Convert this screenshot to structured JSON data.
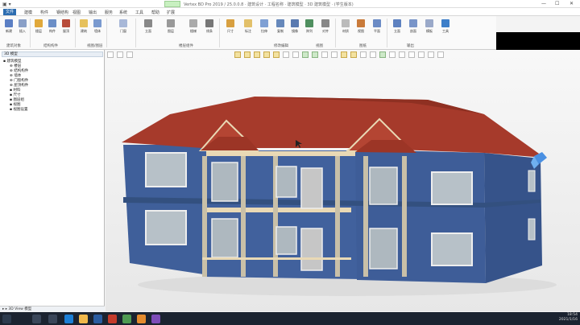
{
  "titlebar": {
    "title": "Vertex BD Pro 2019 / 25.0.0.8 · 建筑设计 · 工程名称 · 建筑模型 · 3D 建筑模型 · (学生版本)",
    "quick_access": "▣ ▾",
    "min": "—",
    "max": "☐",
    "close": "✕"
  },
  "menu": {
    "items": [
      "文件",
      "建模",
      "构件",
      "钢结构",
      "视图",
      "输出",
      "服务",
      "系统",
      "工具",
      "帮助",
      "扩展"
    ]
  },
  "ribbon": {
    "buttons": [
      "新建",
      "插入",
      "楼层",
      "构件",
      "屋顶",
      "建筑",
      "墙体",
      "门窗",
      "立面",
      "图层",
      "楼梯",
      "线条",
      "尺寸",
      "标注",
      "拉伸",
      "复制",
      "镜像",
      "阵列",
      "对齐",
      "材质",
      "视图",
      "平面",
      "立面",
      "剖面",
      "模板",
      "截图",
      "编辑",
      "渲染",
      "工具"
    ],
    "groups": [
      "建筑对象",
      "结构构件",
      "视图/图层",
      "楼层组件",
      "修改编辑",
      "视图",
      "图纸",
      "输出"
    ]
  },
  "tree": {
    "header": "3D 模型",
    "rows": [
      "▪ 建筑模型",
      "⊕ 楼层",
      "⊕ 结构构件",
      "⊕ 墙体",
      "⊕ 门窗构件",
      "⊕ 屋顶构件",
      "  ▪ 材料",
      "  ▪ 尺寸",
      "  ▪ 图层组",
      "  ▪ 视图",
      "  ▪ 视图设置"
    ],
    "footer": "▸ ▸ 3D View 模型"
  },
  "clock": {
    "time": "18:54",
    "date": "2021/1/16"
  },
  "colors": {
    "accent": "#2b6cb0",
    "roof": "#a63a2b",
    "wall": "#3f5f9a",
    "trim": "#e9d9b5"
  }
}
